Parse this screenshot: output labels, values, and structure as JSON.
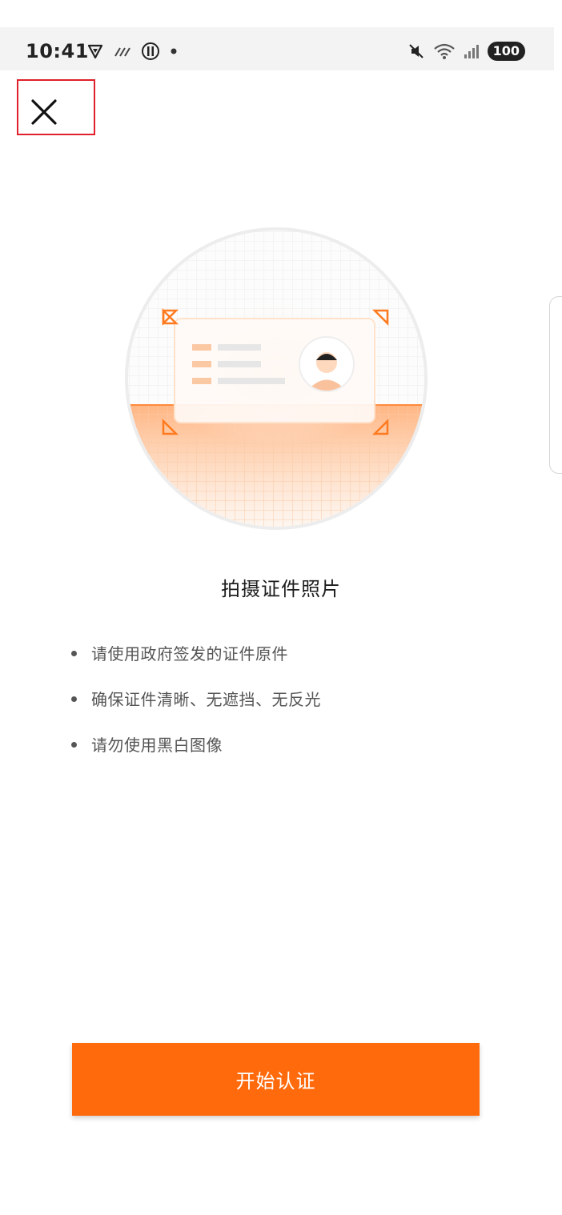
{
  "status_bar": {
    "time": "10:41",
    "battery": "100",
    "left_icons": [
      "vpn-shield-icon",
      "data-transfer-icon",
      "app-notification-icon",
      "dot-icon"
    ],
    "right_icons": [
      "mute-icon",
      "wifi-icon",
      "signal-icon",
      "battery-icon"
    ]
  },
  "header": {
    "close_icon": "close-icon"
  },
  "main": {
    "title": "拍摄证件照片",
    "tips": [
      "请使用政府签发的证件原件",
      "确保证件清晰、无遮挡、无反光",
      "请勿使用黑白图像"
    ]
  },
  "footer": {
    "start_button": "开始认证"
  },
  "colors": {
    "accent": "#ff6a0c",
    "highlight_border": "#e0202a"
  }
}
